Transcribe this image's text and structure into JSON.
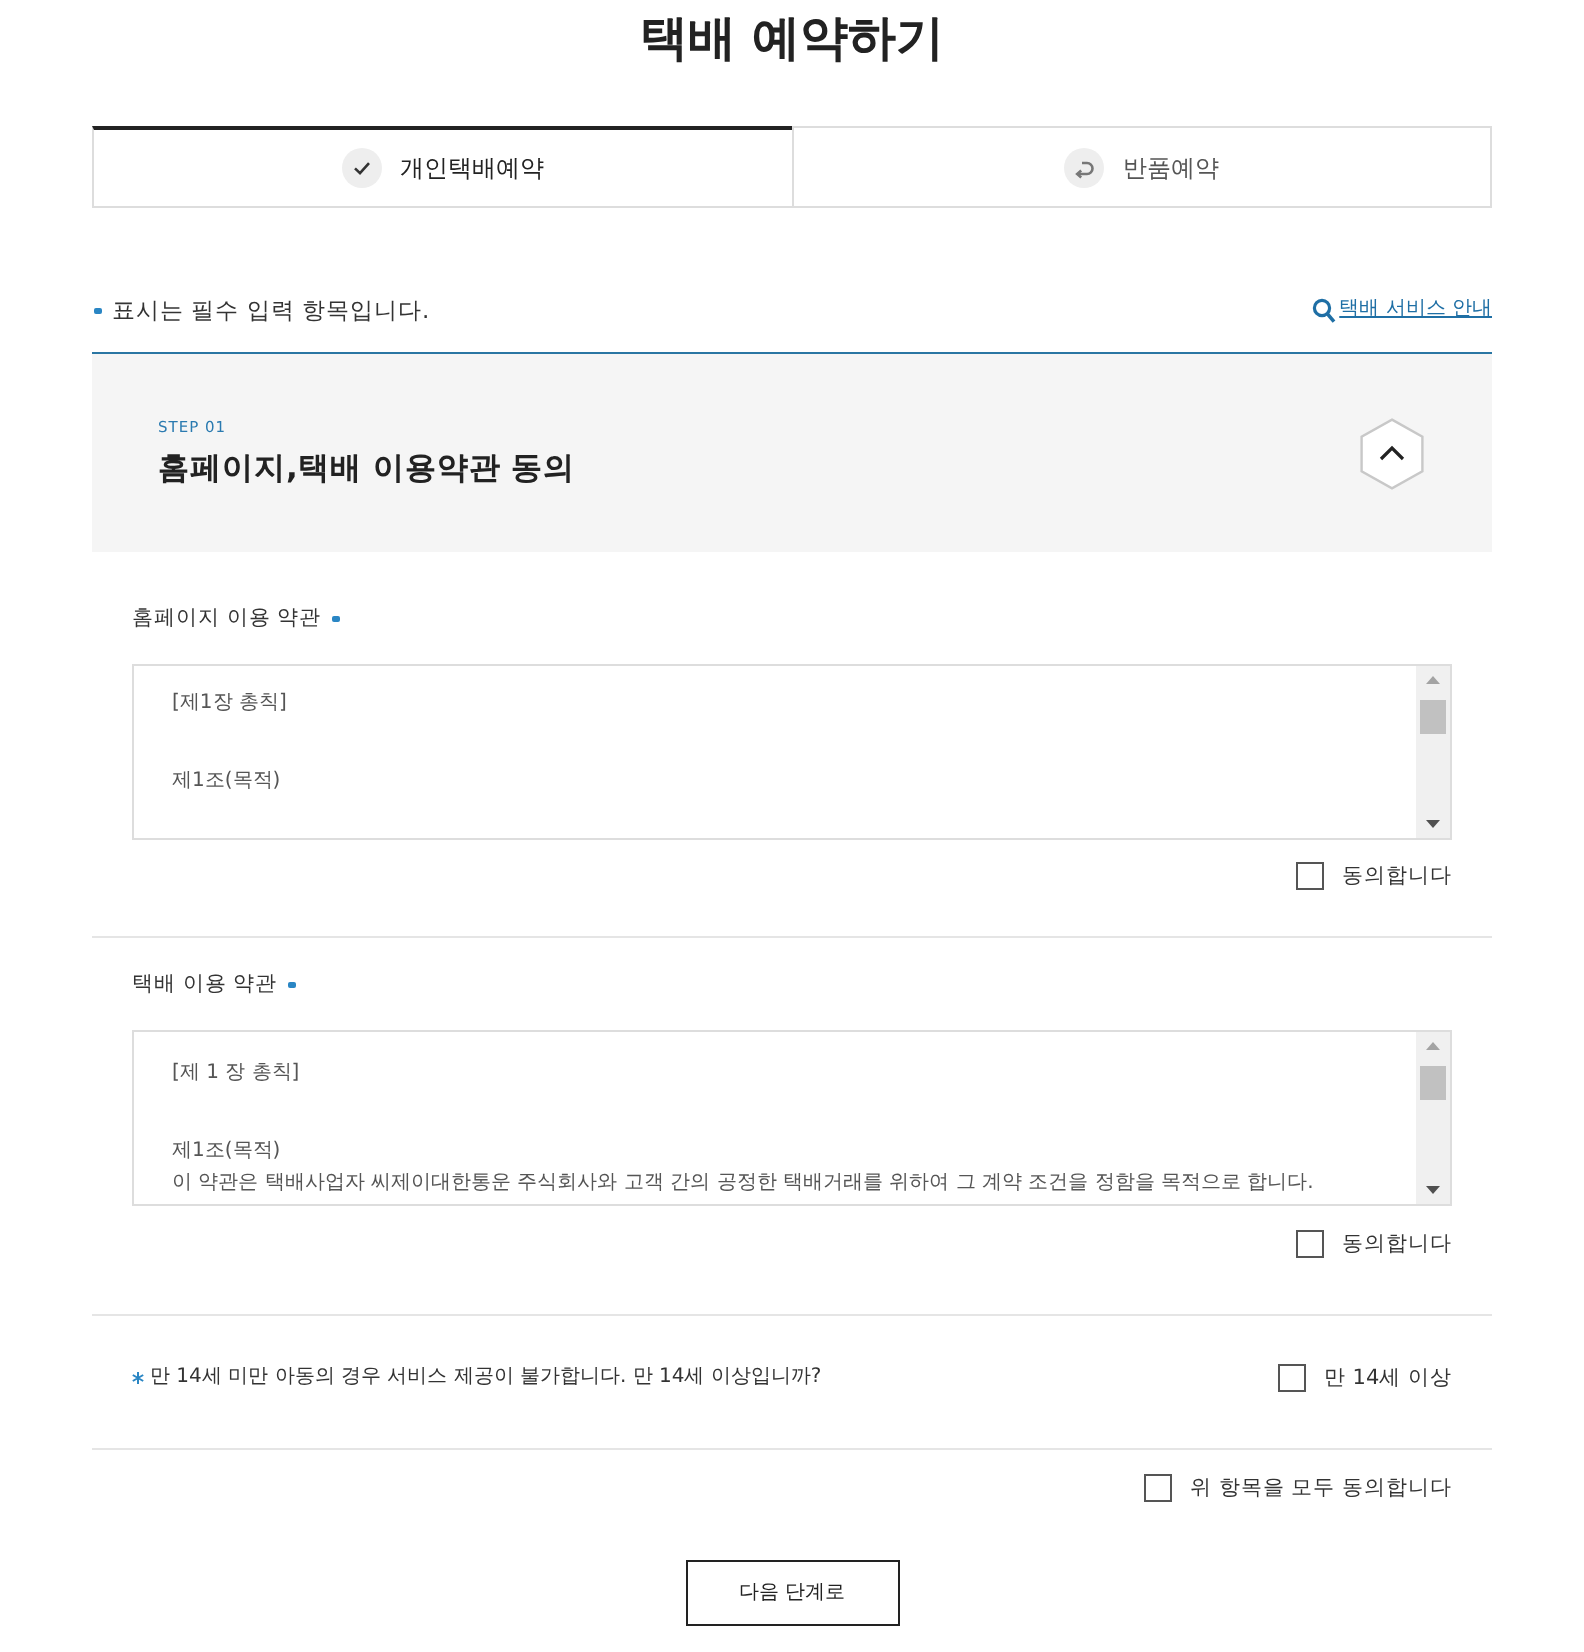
{
  "page": {
    "title": "택배 예약하기"
  },
  "tabs": [
    {
      "label": "개인택배예약",
      "kind": "check",
      "selected": true
    },
    {
      "label": "반품예약",
      "kind": "return",
      "selected": false
    }
  ],
  "required_note": {
    "text": "표시는 필수 입력 항목입니다."
  },
  "service_link": {
    "label": "택배 서비스 안내"
  },
  "step": {
    "number": "STEP 01",
    "title": "홈페이지,택배 이용약관 동의",
    "expanded": true
  },
  "terms": [
    {
      "label": "홈페이지 이용 약관",
      "required": true,
      "paragraphs": [
        [
          "[제1장 총칙]"
        ],
        [
          "제1조(목적)"
        ]
      ],
      "agree": {
        "label": "동의합니다",
        "checked": false
      }
    },
    {
      "label": "택배 이용 약관",
      "required": true,
      "paragraphs": [
        [
          "[제 1 장 총칙]"
        ],
        [
          "제1조(목적)",
          "이 약관은 택배사업자 씨제이대한통운 주식회사와 고객 간의 공정한 택배거래를 위하여 그 계약 조건을 정함을 목적으로 합니다."
        ]
      ],
      "agree": {
        "label": "동의합니다",
        "checked": false
      }
    }
  ],
  "age_question": {
    "text": "만 14세 미만 아동의 경우 서비스 제공이 불가합니다. 만 14세 이상입니까?",
    "required": true,
    "checkbox": {
      "label": "만 14세 이상",
      "checked": false
    }
  },
  "agree_all": {
    "label": "위 항목을 모두 동의합니다",
    "checked": false
  },
  "next_button": {
    "label": "다음 단계로"
  }
}
